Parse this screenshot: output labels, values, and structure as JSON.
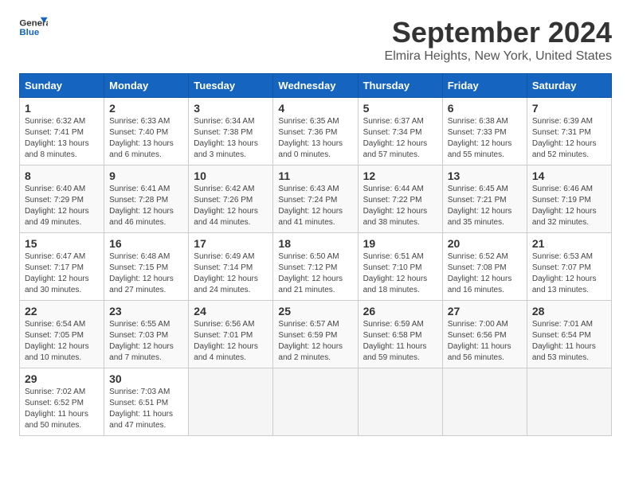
{
  "header": {
    "logo_line1": "General",
    "logo_line2": "Blue",
    "month": "September 2024",
    "location": "Elmira Heights, New York, United States"
  },
  "weekdays": [
    "Sunday",
    "Monday",
    "Tuesday",
    "Wednesday",
    "Thursday",
    "Friday",
    "Saturday"
  ],
  "weeks": [
    [
      {
        "day": 1,
        "sunrise": "6:32 AM",
        "sunset": "7:41 PM",
        "daylight": "13 hours and 8 minutes."
      },
      {
        "day": 2,
        "sunrise": "6:33 AM",
        "sunset": "7:40 PM",
        "daylight": "13 hours and 6 minutes."
      },
      {
        "day": 3,
        "sunrise": "6:34 AM",
        "sunset": "7:38 PM",
        "daylight": "13 hours and 3 minutes."
      },
      {
        "day": 4,
        "sunrise": "6:35 AM",
        "sunset": "7:36 PM",
        "daylight": "13 hours and 0 minutes."
      },
      {
        "day": 5,
        "sunrise": "6:37 AM",
        "sunset": "7:34 PM",
        "daylight": "12 hours and 57 minutes."
      },
      {
        "day": 6,
        "sunrise": "6:38 AM",
        "sunset": "7:33 PM",
        "daylight": "12 hours and 55 minutes."
      },
      {
        "day": 7,
        "sunrise": "6:39 AM",
        "sunset": "7:31 PM",
        "daylight": "12 hours and 52 minutes."
      }
    ],
    [
      {
        "day": 8,
        "sunrise": "6:40 AM",
        "sunset": "7:29 PM",
        "daylight": "12 hours and 49 minutes."
      },
      {
        "day": 9,
        "sunrise": "6:41 AM",
        "sunset": "7:28 PM",
        "daylight": "12 hours and 46 minutes."
      },
      {
        "day": 10,
        "sunrise": "6:42 AM",
        "sunset": "7:26 PM",
        "daylight": "12 hours and 44 minutes."
      },
      {
        "day": 11,
        "sunrise": "6:43 AM",
        "sunset": "7:24 PM",
        "daylight": "12 hours and 41 minutes."
      },
      {
        "day": 12,
        "sunrise": "6:44 AM",
        "sunset": "7:22 PM",
        "daylight": "12 hours and 38 minutes."
      },
      {
        "day": 13,
        "sunrise": "6:45 AM",
        "sunset": "7:21 PM",
        "daylight": "12 hours and 35 minutes."
      },
      {
        "day": 14,
        "sunrise": "6:46 AM",
        "sunset": "7:19 PM",
        "daylight": "12 hours and 32 minutes."
      }
    ],
    [
      {
        "day": 15,
        "sunrise": "6:47 AM",
        "sunset": "7:17 PM",
        "daylight": "12 hours and 30 minutes."
      },
      {
        "day": 16,
        "sunrise": "6:48 AM",
        "sunset": "7:15 PM",
        "daylight": "12 hours and 27 minutes."
      },
      {
        "day": 17,
        "sunrise": "6:49 AM",
        "sunset": "7:14 PM",
        "daylight": "12 hours and 24 minutes."
      },
      {
        "day": 18,
        "sunrise": "6:50 AM",
        "sunset": "7:12 PM",
        "daylight": "12 hours and 21 minutes."
      },
      {
        "day": 19,
        "sunrise": "6:51 AM",
        "sunset": "7:10 PM",
        "daylight": "12 hours and 18 minutes."
      },
      {
        "day": 20,
        "sunrise": "6:52 AM",
        "sunset": "7:08 PM",
        "daylight": "12 hours and 16 minutes."
      },
      {
        "day": 21,
        "sunrise": "6:53 AM",
        "sunset": "7:07 PM",
        "daylight": "12 hours and 13 minutes."
      }
    ],
    [
      {
        "day": 22,
        "sunrise": "6:54 AM",
        "sunset": "7:05 PM",
        "daylight": "12 hours and 10 minutes."
      },
      {
        "day": 23,
        "sunrise": "6:55 AM",
        "sunset": "7:03 PM",
        "daylight": "12 hours and 7 minutes."
      },
      {
        "day": 24,
        "sunrise": "6:56 AM",
        "sunset": "7:01 PM",
        "daylight": "12 hours and 4 minutes."
      },
      {
        "day": 25,
        "sunrise": "6:57 AM",
        "sunset": "6:59 PM",
        "daylight": "12 hours and 2 minutes."
      },
      {
        "day": 26,
        "sunrise": "6:59 AM",
        "sunset": "6:58 PM",
        "daylight": "11 hours and 59 minutes."
      },
      {
        "day": 27,
        "sunrise": "7:00 AM",
        "sunset": "6:56 PM",
        "daylight": "11 hours and 56 minutes."
      },
      {
        "day": 28,
        "sunrise": "7:01 AM",
        "sunset": "6:54 PM",
        "daylight": "11 hours and 53 minutes."
      }
    ],
    [
      {
        "day": 29,
        "sunrise": "7:02 AM",
        "sunset": "6:52 PM",
        "daylight": "11 hours and 50 minutes."
      },
      {
        "day": 30,
        "sunrise": "7:03 AM",
        "sunset": "6:51 PM",
        "daylight": "11 hours and 47 minutes."
      },
      null,
      null,
      null,
      null,
      null
    ]
  ]
}
